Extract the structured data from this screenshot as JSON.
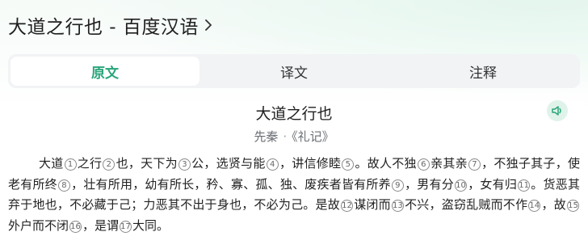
{
  "header": {
    "title": "大道之行也 - 百度汉语"
  },
  "tabs": [
    {
      "label": "原文",
      "active": true
    },
    {
      "label": "译文",
      "active": false
    },
    {
      "label": "注释",
      "active": false
    }
  ],
  "poem": {
    "title": "大道之行也",
    "dynasty": "先秦",
    "dot": "·",
    "source": "《礼记》",
    "segments": [
      {
        "t": "大道"
      },
      {
        "n": "1"
      },
      {
        "t": "之行"
      },
      {
        "n": "2"
      },
      {
        "t": "也，天下为"
      },
      {
        "n": "3"
      },
      {
        "t": "公，选贤与能"
      },
      {
        "n": "4"
      },
      {
        "t": "，讲信修睦"
      },
      {
        "n": "5"
      },
      {
        "t": "。故人不独"
      },
      {
        "n": "6"
      },
      {
        "t": "亲其亲"
      },
      {
        "n": "7"
      },
      {
        "t": "，不独子其子，使老有所终"
      },
      {
        "n": "8"
      },
      {
        "t": "，壮有所用，幼有所长，矜、寡、孤、独、废疾者皆有所养"
      },
      {
        "n": "9"
      },
      {
        "t": "，男有分"
      },
      {
        "n": "10"
      },
      {
        "t": "，女有归"
      },
      {
        "n": "11"
      },
      {
        "t": "。货恶其弃于地也，不必藏于己；力恶其不出于身也，不必为己。是故"
      },
      {
        "n": "12"
      },
      {
        "t": "谋闭而"
      },
      {
        "n": "13"
      },
      {
        "t": "不兴，盗窃乱贼而不作"
      },
      {
        "n": "14"
      },
      {
        "t": "，故"
      },
      {
        "n": "15"
      },
      {
        "t": "外户而不闭"
      },
      {
        "n": "16"
      },
      {
        "t": "，是谓"
      },
      {
        "n": "17"
      },
      {
        "t": "大同。"
      }
    ]
  },
  "colors": {
    "accent": "#2aa57a",
    "tab_bg": "#f1f3f5",
    "audio_bg": "#dff3ea"
  },
  "icons": {
    "header_chevron": "chevron-right-icon",
    "audio": "speaker-icon"
  }
}
